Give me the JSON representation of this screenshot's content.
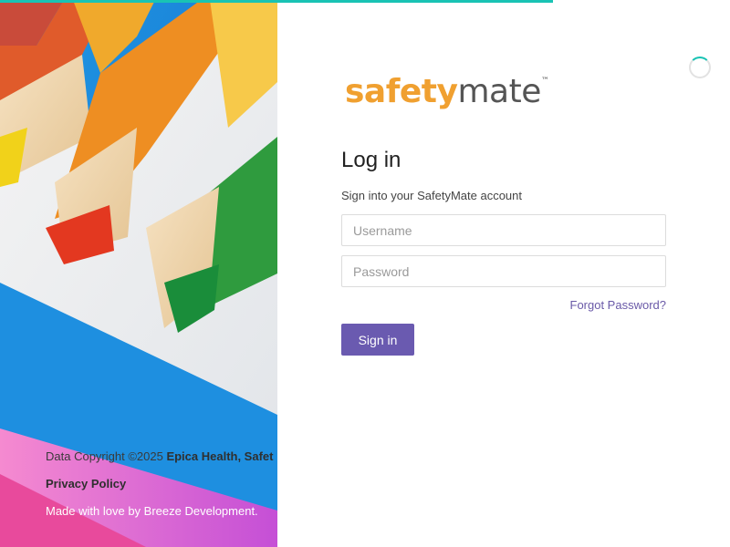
{
  "progress": {
    "fraction": 0.757,
    "color": "#19c3b4"
  },
  "brand": {
    "logo_primary": "safety",
    "logo_secondary": "mate",
    "logo_tm": "™",
    "primary_color": "#f0a030",
    "accent_color": "#6a5ab0"
  },
  "login": {
    "title": "Log in",
    "subtitle": "Sign into your SafetyMate account",
    "username_placeholder": "Username",
    "password_placeholder": "Password",
    "forgot_label": "Forgot Password?",
    "signin_label": "Sign in"
  },
  "footer": {
    "copyright_prefix": "Data Copyright ©2025 ",
    "copyright_owner": "Epica Health, Safet",
    "privacy_label": "Privacy Policy",
    "made_by": "Made with love by Breeze Development."
  },
  "loading_indicator": "spinner-icon"
}
